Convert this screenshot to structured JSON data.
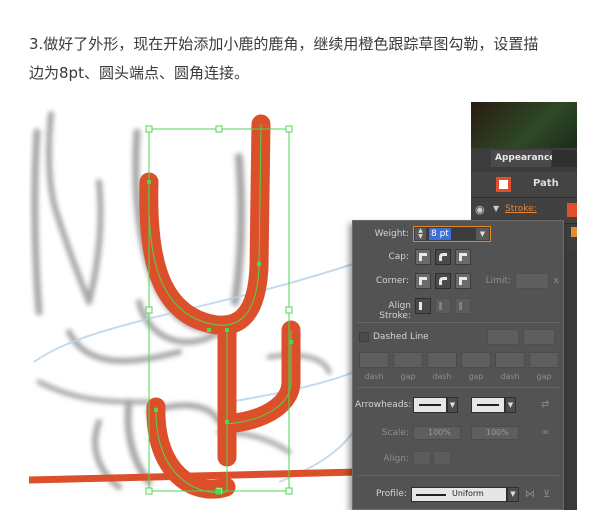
{
  "instruction": {
    "line1": "3.做好了外形，现在开始添加小鹿的鹿角，继续用橙色跟踪草图勾勒，设置描",
    "line2": "边为8pt、圆头端点、圆角连接。"
  },
  "appearance_panel": {
    "tab": "Appearance",
    "path_label": "Path",
    "stroke_label": "Stroke:"
  },
  "stroke_panel": {
    "weight_label": "Weight:",
    "weight_value": "8 pt",
    "cap_label": "Cap:",
    "corner_label": "Corner:",
    "limit_label": "Limit:",
    "limit_suffix": "x",
    "align_label": "Align Stroke:",
    "dashed_label": "Dashed Line",
    "dash_labels": [
      "dash",
      "gap",
      "dash",
      "gap",
      "dash",
      "gap"
    ],
    "arrowheads_label": "Arrowheads:",
    "scale_label": "Scale:",
    "scale_start": "100%",
    "scale_end": "100%",
    "align_arrow_label": "Align:",
    "profile_label": "Profile:",
    "profile_value": "Uniform"
  },
  "colors": {
    "stroke_orange": "#dc4f2b",
    "selection_green": "#4cd94c",
    "panel_bg": "#535353",
    "weight_highlight": "#3d6fd6"
  }
}
